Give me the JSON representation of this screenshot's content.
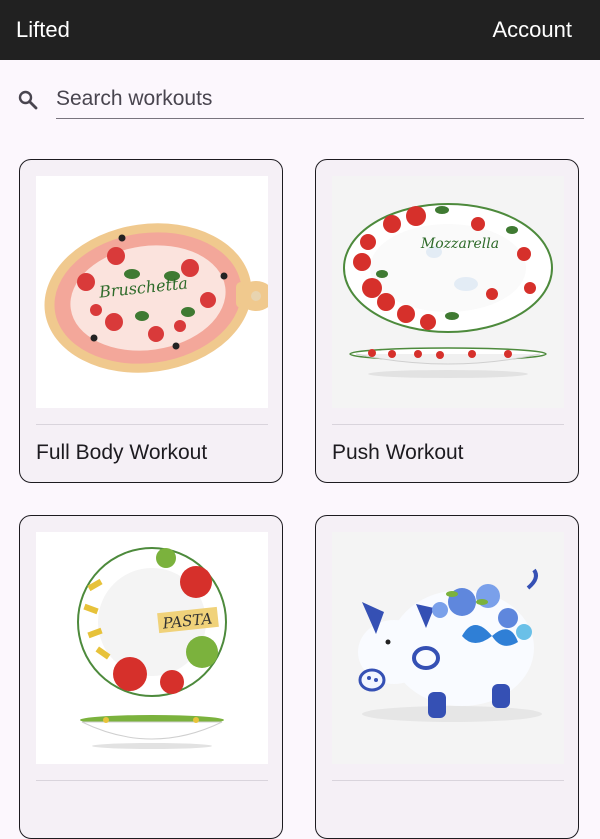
{
  "appbar": {
    "title": "Lifted",
    "account_label": "Account"
  },
  "search": {
    "placeholder": "Search workouts",
    "value": "",
    "icon": "search-icon"
  },
  "workouts": [
    {
      "label": "Full Body Workout",
      "image": "bruschetta-plate"
    },
    {
      "label": "Push Workout",
      "image": "mozzarella-platter"
    },
    {
      "label": "",
      "image": "pasta-bowl"
    },
    {
      "label": "",
      "image": "ceramic-pig"
    }
  ],
  "image_text": {
    "bruschetta": "Bruschetta",
    "mozzarella": "Mozzarella",
    "pasta": "PASTA"
  },
  "colors": {
    "appbar": "#212121",
    "background": "#fcf7fd",
    "card": "#f5f0f6",
    "border": "#1d1b20"
  }
}
